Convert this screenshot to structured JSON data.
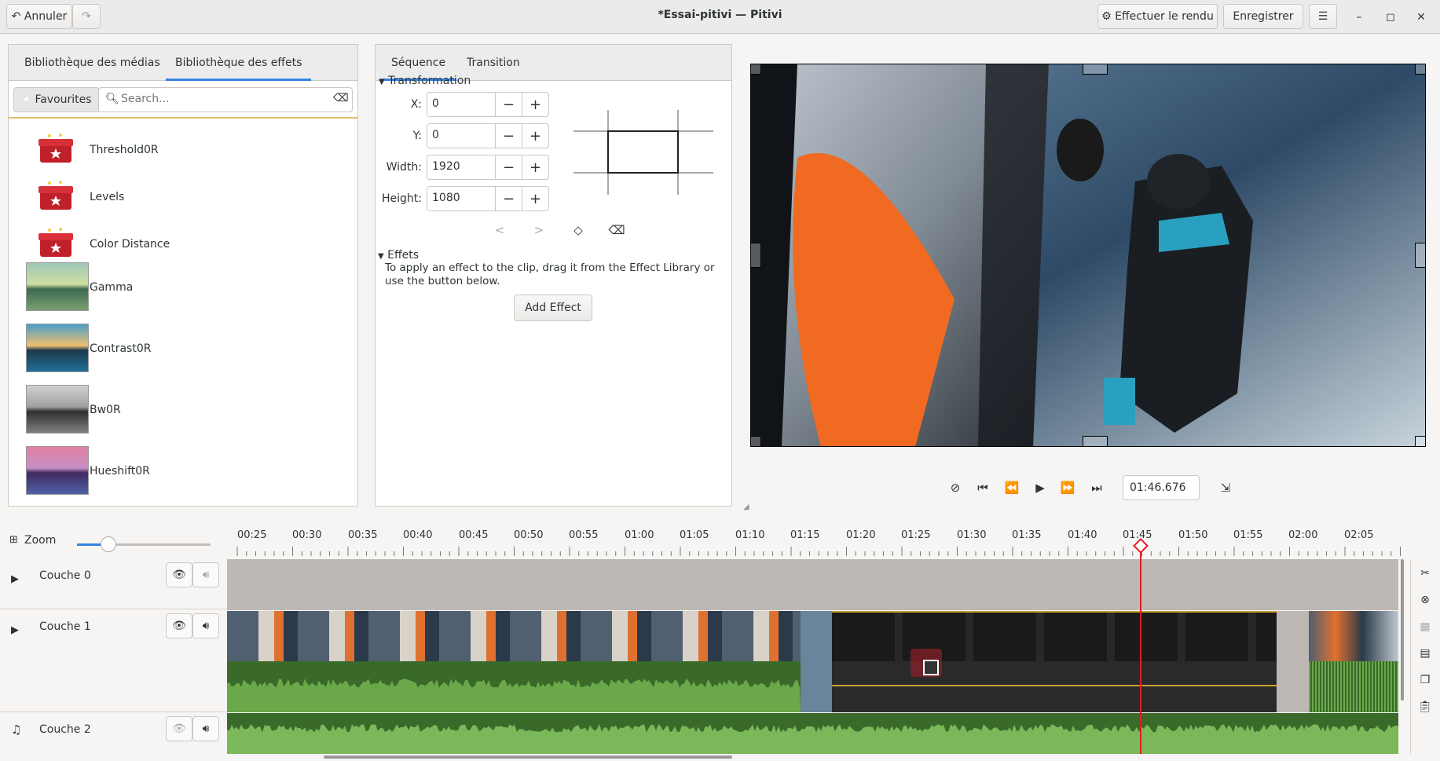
{
  "window": {
    "title": "*Essai-pitivi — Pitivi",
    "undo_label": "Annuler",
    "render_label": "Effectuer le rendu",
    "save_label": "Enregistrer"
  },
  "library": {
    "tabs": [
      {
        "label": "Bibliothèque des médias",
        "active": false
      },
      {
        "label": "Bibliothèque des effets",
        "active": true
      }
    ],
    "favourites_label": "Favourites",
    "search_placeholder": "Search...",
    "effects": [
      {
        "label": "Threshold0R",
        "icon": "gift-icon"
      },
      {
        "label": "Levels",
        "icon": "gift-icon"
      },
      {
        "label": "Color Distance",
        "icon": "gift-icon"
      },
      {
        "label": "Gamma",
        "icon": "landscape-thumbnail"
      },
      {
        "label": "Contrast0R",
        "icon": "landscape-thumbnail"
      },
      {
        "label": "Bw0R",
        "icon": "landscape-thumbnail"
      },
      {
        "label": "Hueshift0R",
        "icon": "landscape-thumbnail"
      }
    ]
  },
  "clip_panel": {
    "tabs": [
      {
        "label": "Séquence",
        "active": true
      },
      {
        "label": "Transition",
        "active": false
      }
    ],
    "transformation_label": "Transformation",
    "fields": [
      {
        "label": "X:",
        "value": "0"
      },
      {
        "label": "Y:",
        "value": "0"
      },
      {
        "label": "Width:",
        "value": "1920"
      },
      {
        "label": "Height:",
        "value": "1080"
      }
    ],
    "effects_label": "Effets",
    "effects_help": "To apply an effect to the clip, drag it from the Effect Library or use the button below.",
    "add_effect_label": "Add Effect"
  },
  "viewer": {
    "timecode": "01:46.676"
  },
  "timeline": {
    "zoom_label": "Zoom",
    "ruler": [
      "00:25",
      "00:30",
      "00:35",
      "00:40",
      "00:45",
      "00:50",
      "00:55",
      "01:00",
      "01:05",
      "01:10",
      "01:15",
      "01:20",
      "01:25",
      "01:30",
      "01:35",
      "01:40",
      "01:45",
      "01:50",
      "01:55",
      "02:00",
      "02:05"
    ],
    "layers": [
      {
        "name": "Couche 0"
      },
      {
        "name": "Couche 1"
      },
      {
        "name": "Couche 2"
      }
    ]
  }
}
